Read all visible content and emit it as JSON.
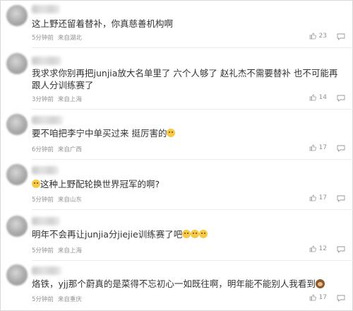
{
  "comments": [
    {
      "text": "这上野还留着替补，你真慈善机构啊",
      "time": "5分钟前",
      "location": "来自湖北",
      "likes": "23"
    },
    {
      "text": "我求求你别再把junjia放大名单里了 六个人够了 赵礼杰不需要替补 也不可能再跟人分训练赛了",
      "time": "3分钟前",
      "location": "来自上海",
      "likes": "14"
    },
    {
      "text": "要不咱把李宁中单买过来 挺厉害的",
      "emoji": "sweat-smile-emoji",
      "time": "6分钟前",
      "location": "来自广西",
      "likes": "17"
    },
    {
      "text": "这种上野配轮换世界冠军的啊?",
      "emoji": "smile-emoji",
      "time": "5分钟前",
      "location": "来自山东",
      "likes": "17"
    },
    {
      "text": "明年不会再让junjia分jiejie训练赛了吧",
      "emoji": "smile-emoji-x3",
      "time": "5分钟前",
      "location": "来自上海",
      "likes": "12"
    },
    {
      "text": "烙铁，yjj那个蔚真的是菜得不忘初心一如既往啊，明年能不能别人我看到",
      "emoji": "monkey-emoji",
      "time": "5分钟前",
      "location": "来自重庆",
      "likes": "17"
    }
  ]
}
